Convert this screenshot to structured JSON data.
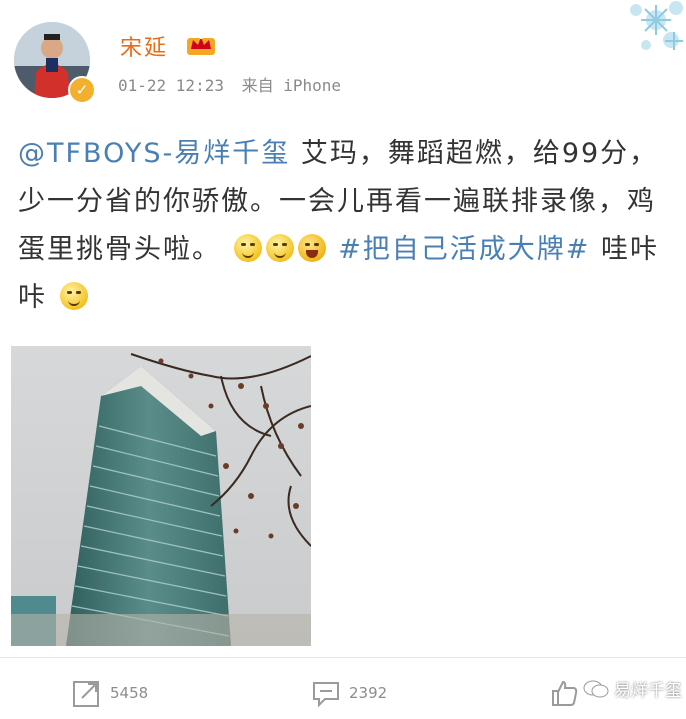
{
  "post": {
    "author": "宋延",
    "timestamp": "01-22 12:23",
    "source": "来自 iPhone",
    "mention": "@TFBOYS-易烊千玺",
    "text_1": " 艾玛，舞蹈超燃，给99分，少一分省的你骄傲。一会儿再看一遍联排录像，鸡蛋里挑骨头啦。",
    "hashtag": "#把自己活成大牌#",
    "text_2": " 哇咔咔",
    "emojis": [
      "smirk-emoji",
      "grin-emoji",
      "laugh-emoji",
      "smirk-emoji"
    ]
  },
  "photo": {
    "subject": "high-rise-building-with-branches"
  },
  "actions": {
    "repost_count": "5458",
    "comment_count": "2392"
  },
  "watermark": {
    "label": "易烊千玺"
  },
  "colors": {
    "username": "#e86b16",
    "link": "#4a7fb5",
    "meta": "#8a8a8a",
    "text": "#333333"
  }
}
